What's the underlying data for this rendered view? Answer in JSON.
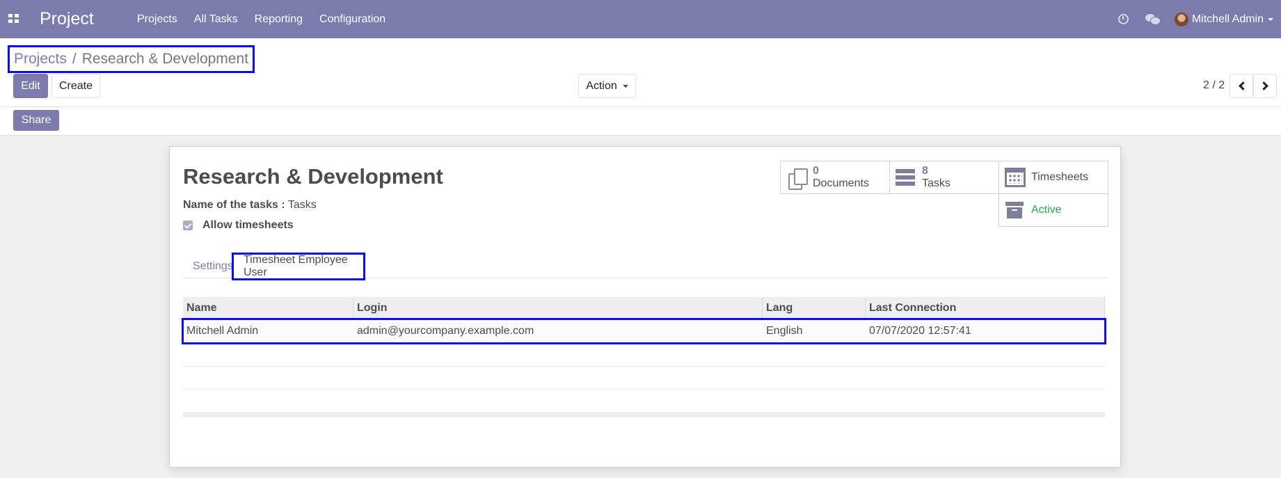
{
  "navbar": {
    "brand": "Project",
    "menu": [
      "Projects",
      "All Tasks",
      "Reporting",
      "Configuration"
    ],
    "user": "Mitchell Admin"
  },
  "breadcrumb": {
    "parent": "Projects",
    "separator": "/",
    "current": "Research & Development"
  },
  "toolbar": {
    "edit": "Edit",
    "create": "Create",
    "action": "Action",
    "share": "Share"
  },
  "pager": {
    "value": "2 / 2"
  },
  "form": {
    "title": "Research & Development",
    "tasks_label": "Name of the tasks :",
    "tasks_value": "Tasks",
    "allow_timesheets": "Allow timesheets",
    "allow_timesheets_checked": true
  },
  "smart_buttons": {
    "documents": {
      "value": "0",
      "label": "Documents"
    },
    "tasks": {
      "value": "8",
      "label": "Tasks"
    },
    "timesheets": {
      "label": "Timesheets"
    },
    "active": {
      "label": "Active",
      "color": "#28a745"
    }
  },
  "tabs": {
    "settings": "Settings",
    "timesheet_user": "Timesheet Employee User",
    "active": "timesheet_user"
  },
  "table": {
    "headers": [
      "Name",
      "Login",
      "Lang",
      "Last Connection"
    ],
    "rows": [
      [
        "Mitchell Admin",
        "admin@yourcompany.example.com",
        "English",
        "07/07/2020 12:57:41"
      ]
    ]
  },
  "colors": {
    "primary": "#7c7bad",
    "highlight": "#0a0aff"
  }
}
